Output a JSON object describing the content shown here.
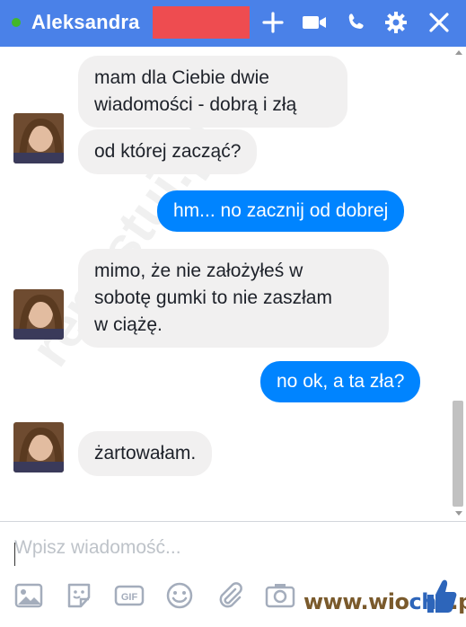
{
  "header": {
    "contact_name": "Aleksandra",
    "status": "online",
    "accent_color": "#4a81e8",
    "icons": [
      "plus-icon",
      "video-call-icon",
      "phone-icon",
      "gear-icon",
      "close-icon"
    ]
  },
  "messages": [
    {
      "from": "contact",
      "text_lines": [
        "mam dla Ciebie dwie",
        "wiadomości - dobrą i złą"
      ]
    },
    {
      "from": "contact",
      "text_lines": [
        "od której zacząć?"
      ]
    },
    {
      "from": "me",
      "text_lines": [
        "hm... no zacznij od dobrej"
      ]
    },
    {
      "from": "contact",
      "text_lines": [
        "mimo, że nie założyłeś w",
        "sobotę gumki to nie zaszłam",
        "w ciążę."
      ]
    },
    {
      "from": "me",
      "text_lines": [
        "no ok, a ta zła?"
      ]
    },
    {
      "from": "contact",
      "text_lines": [
        "żartowałam."
      ]
    }
  ],
  "watermark": "repostuj.pl",
  "composer": {
    "placeholder": "Wpisz wiadomość...",
    "toolbar_icons": [
      "image-icon",
      "sticker-icon",
      "gif-icon",
      "emoji-icon",
      "attachment-icon",
      "camera-icon"
    ]
  },
  "branding": {
    "text_main": "www.wio",
    "text_accent": "cha",
    "text_end": ".pl"
  }
}
